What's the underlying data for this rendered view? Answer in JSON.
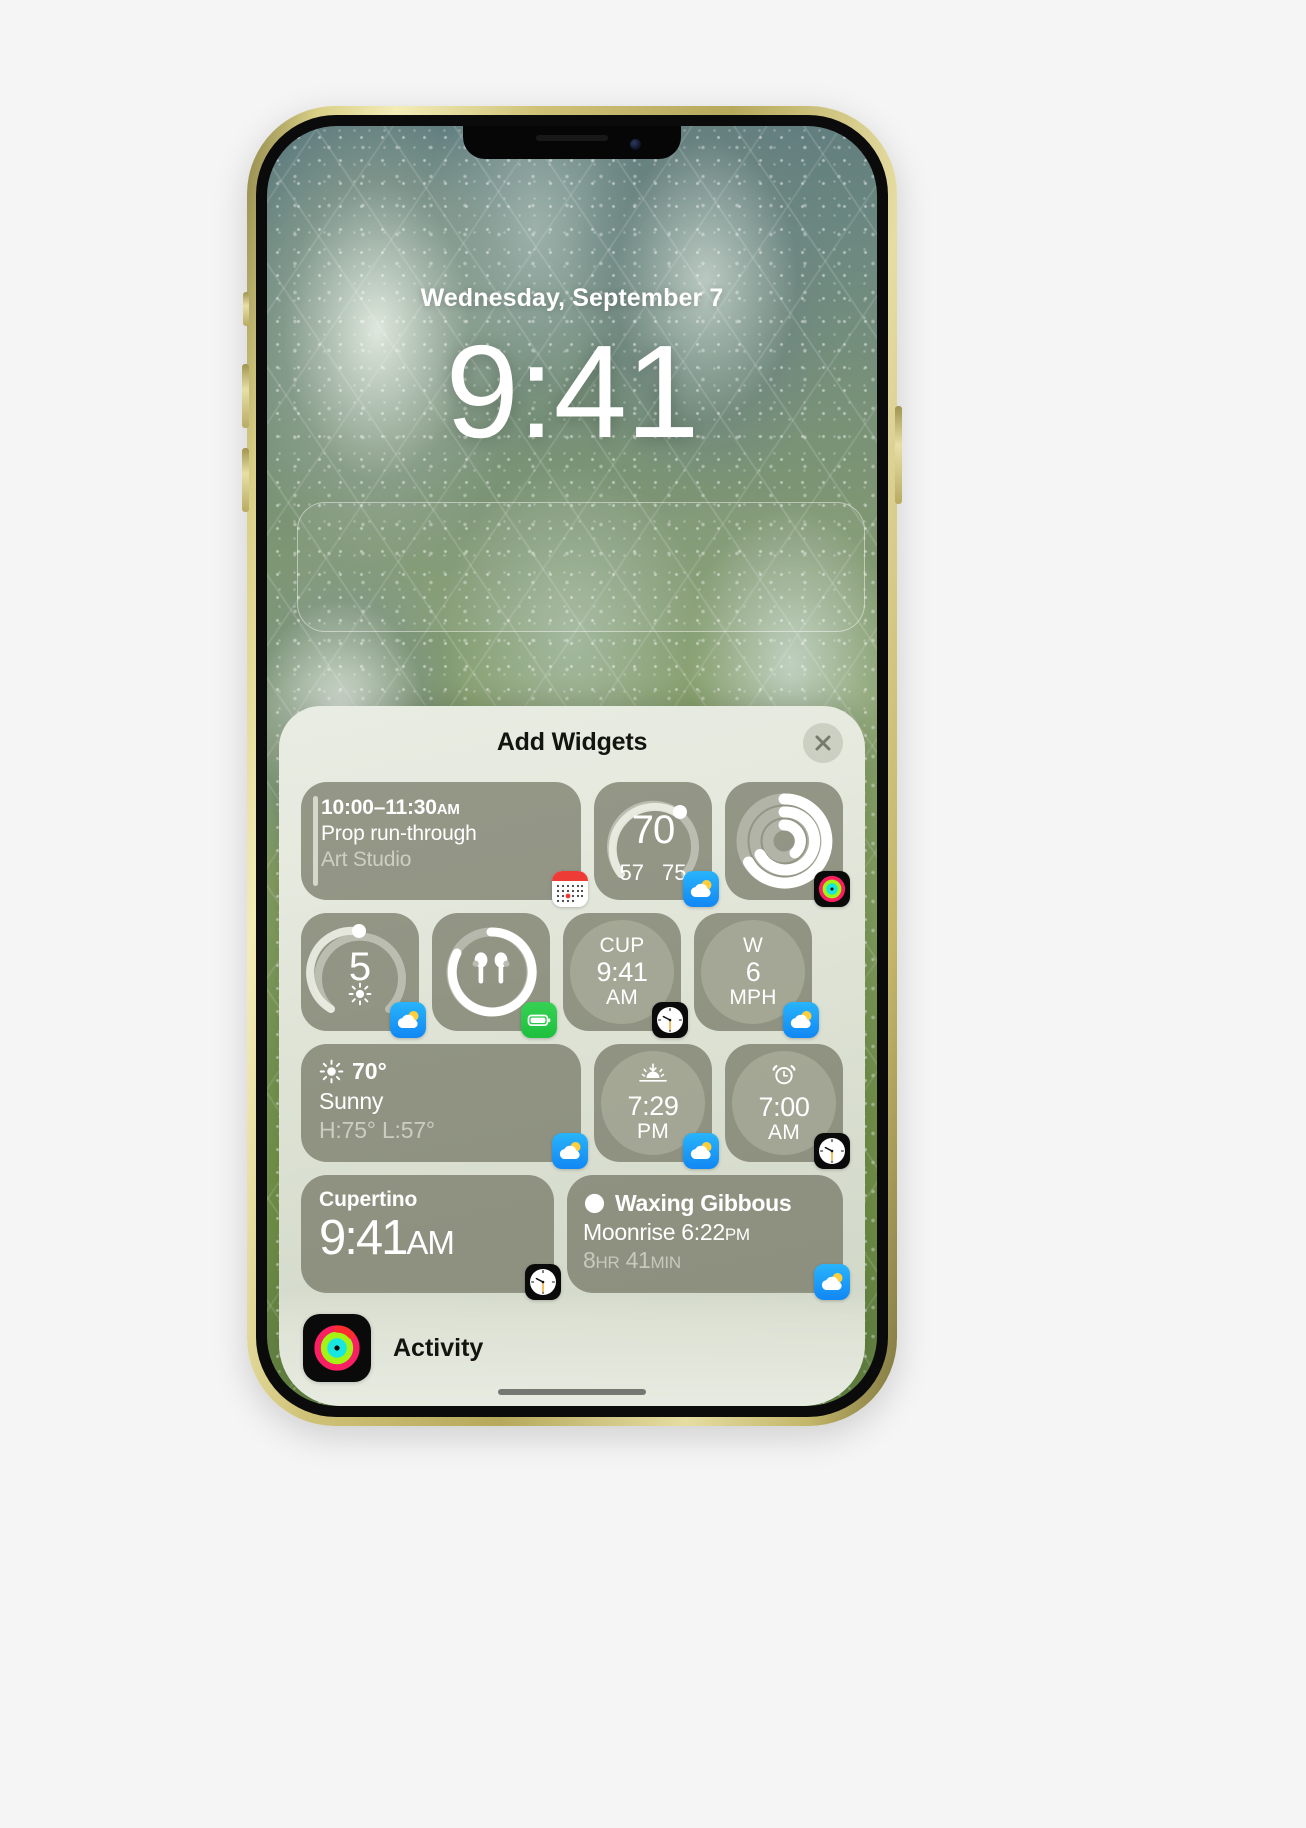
{
  "lock_screen": {
    "date": "Wednesday, September 7",
    "time": "9:41",
    "widget_placeholder_label": ""
  },
  "sheet": {
    "title": "Add Widgets",
    "close_icon": "close-icon"
  },
  "widgets": {
    "calendar_event": {
      "time_range": "10:00–11:30",
      "time_suffix": "AM",
      "event": "Prop run-through",
      "location": "Art Studio",
      "badge": "calendar-app-icon"
    },
    "temperature_gauge": {
      "value": "70",
      "low": "57",
      "high": "75",
      "badge": "weather-app-icon"
    },
    "activity_rings": {
      "badge": "fitness-app-icon"
    },
    "uv_index": {
      "value": "5",
      "glyph": "sun-icon",
      "badge": "weather-app-icon"
    },
    "airpods_battery": {
      "glyph": "airpods-icon",
      "badge": "battery-app-icon"
    },
    "world_clock_small": {
      "city_abbr": "CUP",
      "time": "9:41",
      "period": "AM",
      "badge": "clock-app-icon"
    },
    "wind": {
      "direction": "W",
      "speed": "6",
      "unit": "MPH",
      "badge": "weather-app-icon"
    },
    "weather_conditions": {
      "temperature": "70°",
      "condition": "Sunny",
      "high_low": "H:75° L:57°",
      "glyph": "sun-icon",
      "badge": "weather-app-icon"
    },
    "sunset": {
      "time": "7:29",
      "period": "PM",
      "glyph": "sunset-icon",
      "badge": "weather-app-icon"
    },
    "alarm": {
      "time": "7:00",
      "period": "AM",
      "glyph": "alarm-icon",
      "badge": "clock-app-icon"
    },
    "world_clock_large": {
      "city": "Cupertino",
      "time": "9:41",
      "period": "AM",
      "badge": "clock-app-icon"
    },
    "moon": {
      "phase": "Waxing Gibbous",
      "moonrise_label": "Moonrise 6:22",
      "moonrise_period": "PM",
      "duration_hours": "8",
      "duration_hours_unit": "HR",
      "duration_minutes": "41",
      "duration_minutes_unit": "MIN",
      "glyph": "moon-phase-icon",
      "badge": "weather-app-icon"
    }
  },
  "footer": {
    "app_name": "Activity",
    "icon": "fitness-app-icon"
  },
  "colors": {
    "widget_tile": "#686b58",
    "sheet_background": "#e5e9de",
    "weather_badge": "#1287f4",
    "battery_badge": "#1ec03e",
    "accent_text": "#ffffff"
  }
}
